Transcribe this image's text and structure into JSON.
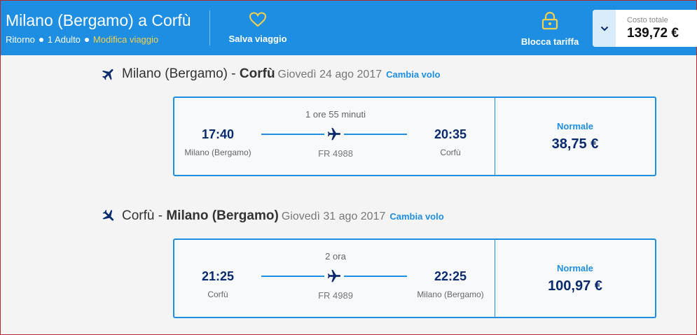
{
  "header": {
    "title": "Milano (Bergamo) a Corfù",
    "trip_type": "Ritorno",
    "passengers": "1 Adulto",
    "modify_link": "Modifica viaggio",
    "save_label": "Salva viaggio",
    "lock_label": "Blocca tariffa",
    "total_label": "Costo totale",
    "total_value": "139,72 €"
  },
  "legs": [
    {
      "route_from": "Milano (Bergamo)",
      "route_sep": " - ",
      "route_to": "Corfù",
      "date": "Giovedì 24 ago 2017",
      "change_label": "Cambia volo",
      "duration": "1 ore 55 minuti",
      "dep_time": "17:40",
      "dep_place": "Milano (Bergamo)",
      "arr_time": "20:35",
      "arr_place": "Corfù",
      "flight_no": "FR 4988",
      "fare_name": "Normale",
      "fare_price": "38,75 €"
    },
    {
      "route_from": "Corfù",
      "route_sep": " - ",
      "route_to": "Milano (Bergamo)",
      "date": "Giovedì 31 ago 2017",
      "change_label": "Cambia volo",
      "duration": "2 ora",
      "dep_time": "21:25",
      "dep_place": "Corfù",
      "arr_time": "22:25",
      "arr_place": "Milano (Bergamo)",
      "flight_no": "FR 4989",
      "fare_name": "Normale",
      "fare_price": "100,97 €"
    }
  ],
  "icons": {
    "save": "heart-icon",
    "lock": "lock-icon",
    "toggle": "chevron-down-icon",
    "leg": "plane-icon"
  },
  "colors": {
    "brand_blue": "#1e8ee3",
    "accent_yellow": "#f4d04d",
    "navy": "#0a2a6e"
  }
}
